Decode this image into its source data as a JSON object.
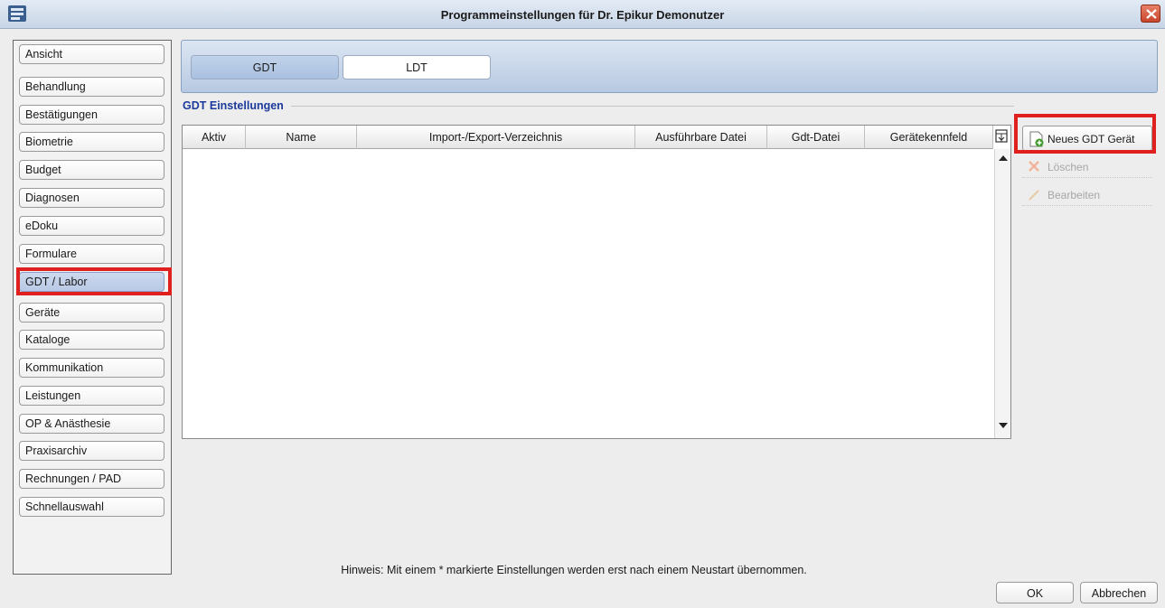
{
  "window": {
    "title": "Programmeinstellungen für Dr. Epikur Demonutzer"
  },
  "sidebar": {
    "items": [
      {
        "label": "Ansicht"
      },
      {
        "label": "Behandlung"
      },
      {
        "label": "Bestätigungen"
      },
      {
        "label": "Biometrie"
      },
      {
        "label": "Budget"
      },
      {
        "label": "Diagnosen"
      },
      {
        "label": "eDoku"
      },
      {
        "label": "Formulare"
      },
      {
        "label": "GDT / Labor",
        "selected": true
      },
      {
        "label": "Geräte"
      },
      {
        "label": "Kataloge"
      },
      {
        "label": "Kommunikation"
      },
      {
        "label": "Leistungen"
      },
      {
        "label": "OP & Anästhesie"
      },
      {
        "label": "Praxisarchiv"
      },
      {
        "label": "Rechnungen / PAD"
      },
      {
        "label": "Schnellauswahl"
      }
    ]
  },
  "tabs": {
    "gdt": "GDT",
    "ldt": "LDT",
    "active": "GDT"
  },
  "section": {
    "title": "GDT Einstellungen"
  },
  "table": {
    "columns": [
      "Aktiv",
      "Name",
      "Import-/Export-Verzeichnis",
      "Ausführbare Datei",
      "Gdt-Datei",
      "Gerätekennfeld"
    ],
    "rows": []
  },
  "actions": {
    "new_device": "Neues GDT Gerät",
    "delete": "Löschen",
    "edit": "Bearbeiten"
  },
  "footer": {
    "hint": "Hinweis: Mit einem * markierte Einstellungen werden erst nach einem Neustart übernommen.",
    "ok": "OK",
    "cancel": "Abbrechen"
  },
  "colors": {
    "highlight": "#e0201e",
    "section_title": "#1c3a9c"
  }
}
